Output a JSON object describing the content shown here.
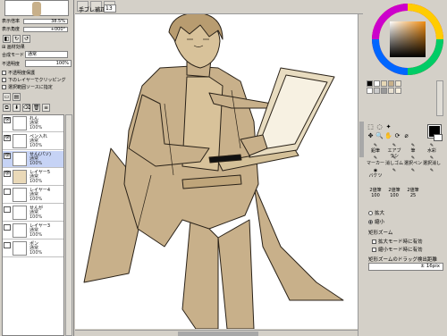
{
  "left_panel": {
    "props": [
      {
        "label": "表示倍率",
        "value": "38.5%"
      },
      {
        "label": "表示角度",
        "value": "+000°"
      }
    ],
    "section_paper": "画材効果",
    "blend_label": "合成モード",
    "blend_value": "通常",
    "opacity_label": "不透明度",
    "opacity_value": "100%",
    "check_preserve": "不透明度保護",
    "check_clip": "下のレイヤーでクリッピング",
    "check_select": "選択範囲ソースに指定",
    "layers": [
      {
        "name": "れん",
        "mode": "通常",
        "pct": "100%"
      },
      {
        "name": "ペン入れ",
        "mode": "通常",
        "pct": "100%"
      },
      {
        "name": "せん(パソ)",
        "mode": "通常",
        "pct": "100%"
      },
      {
        "name": "レイヤー5",
        "mode": "通常",
        "pct": "100%"
      },
      {
        "name": "レイヤー4",
        "mode": "通常",
        "pct": "100%"
      },
      {
        "name": "せんが",
        "mode": "通常",
        "pct": "100%"
      },
      {
        "name": "レイヤー3",
        "mode": "通常",
        "pct": "100%"
      },
      {
        "name": "ポン",
        "mode": "通常",
        "pct": "100%"
      }
    ]
  },
  "top_bar": {
    "stabilizer_label": "手ブレ補正",
    "stabilizer_value": "13"
  },
  "right_panel": {
    "tools_row1": [
      "鉛筆",
      "エアブラシ",
      "筆",
      "水彩"
    ],
    "tools_row2": [
      "マーカー",
      "消しゴム",
      "選択ペン",
      "選択消し"
    ],
    "tools_row3": [
      "バケツ",
      "",
      "",
      ""
    ],
    "sizes": [
      {
        "label": "2値筆",
        "value": "100"
      },
      {
        "label": "2値筆",
        "value": "100"
      },
      {
        "label": "2値筆",
        "value": "25"
      }
    ],
    "zoom_in": "拡大",
    "zoom_out": "縮小",
    "rect_zoom_title": "矩形ズーム",
    "rect_zoom_opt1": "拡大モード時に有効",
    "rect_zoom_opt2": "縮小モード時に有効",
    "drag_threshold_label": "矩形ズームのドラッグ検出距離",
    "drag_threshold_value": "± 16pix"
  },
  "colors": {
    "fill": "#c8b08a",
    "line": "#2a2218",
    "selected_layer": "#c6d3f5"
  }
}
